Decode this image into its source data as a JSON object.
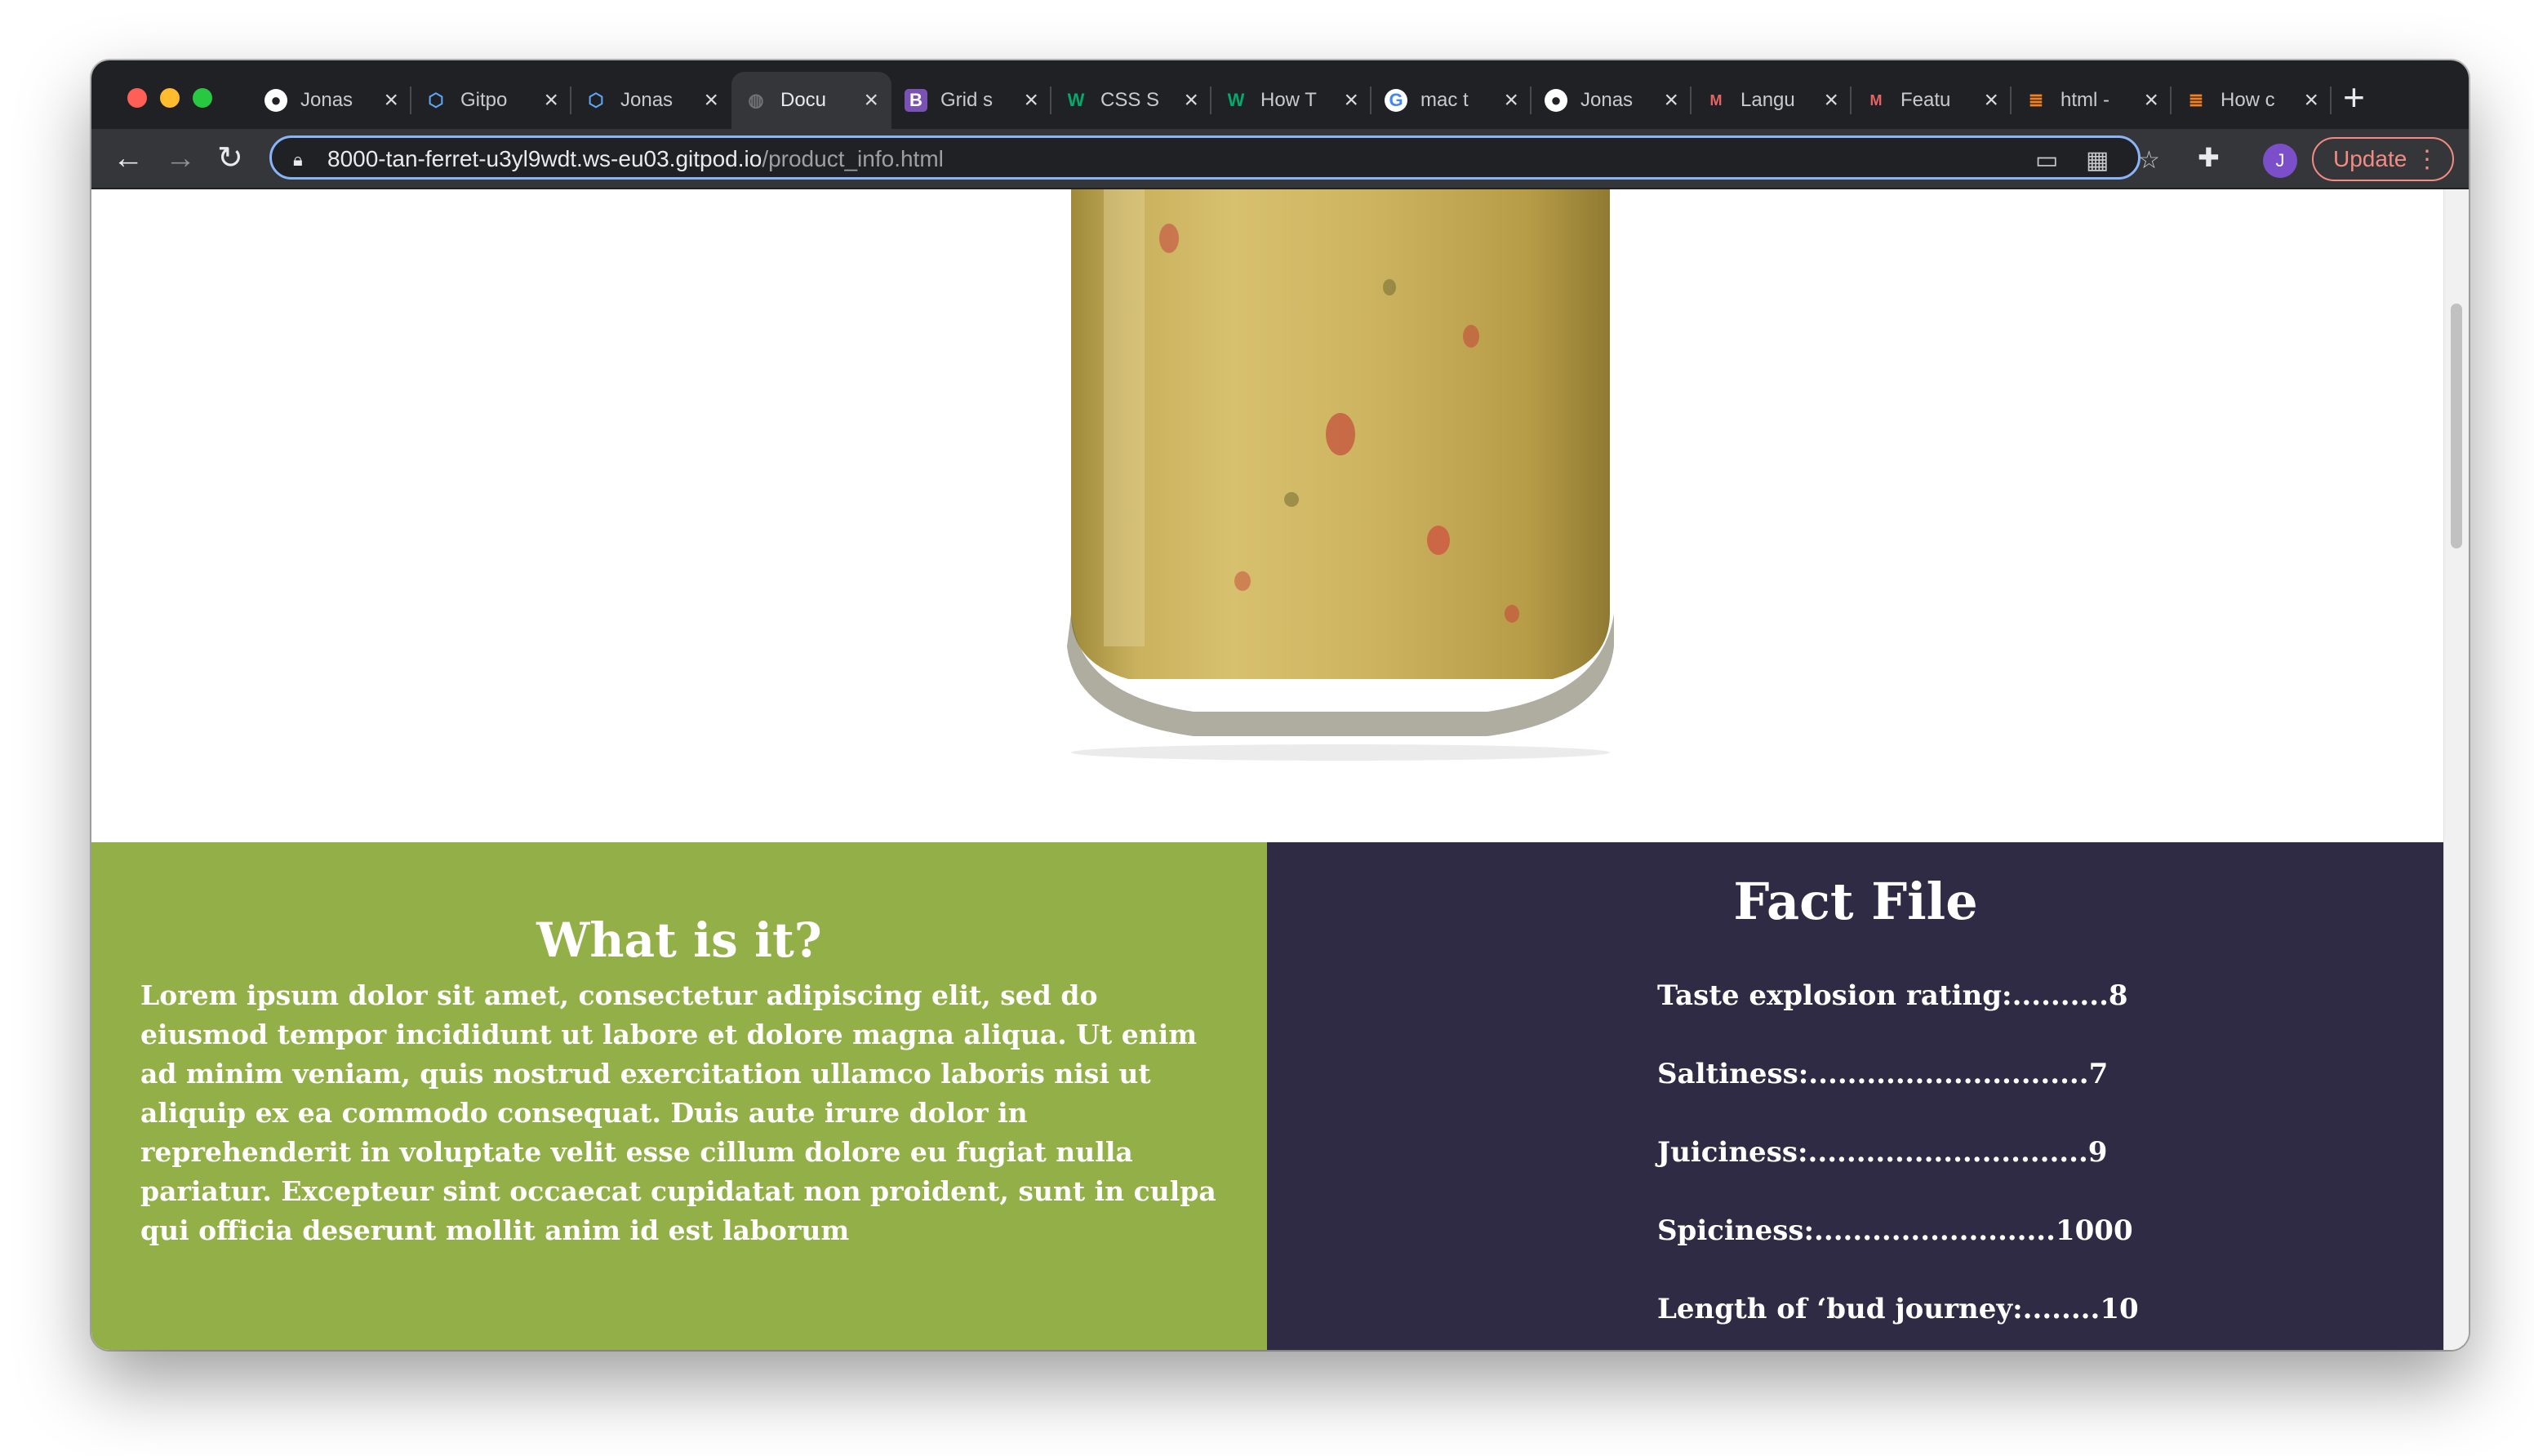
{
  "browser": {
    "tabs": [
      {
        "title": "Jonas",
        "icon": "github-icon",
        "active": false
      },
      {
        "title": "Gitpo",
        "icon": "gitpod-icon",
        "active": false
      },
      {
        "title": "Jonas",
        "icon": "gitpod-icon",
        "active": false
      },
      {
        "title": "Docu",
        "icon": "globe-icon",
        "active": true
      },
      {
        "title": "Grid s",
        "icon": "bootstrap-icon",
        "active": false
      },
      {
        "title": "CSS S",
        "icon": "w3schools-icon",
        "active": false
      },
      {
        "title": "How T",
        "icon": "w3schools-icon",
        "active": false
      },
      {
        "title": "mac t",
        "icon": "google-icon",
        "active": false
      },
      {
        "title": "Jonas",
        "icon": "github-icon",
        "active": false
      },
      {
        "title": "Langu",
        "icon": "mdn-icon",
        "active": false
      },
      {
        "title": "Featu",
        "icon": "mdn-icon",
        "active": false
      },
      {
        "title": "html -",
        "icon": "stackoverflow-icon",
        "active": false
      },
      {
        "title": "How c",
        "icon": "stackoverflow-icon",
        "active": false
      }
    ],
    "url_host": "8000-tan-ferret-u3yl9wdt.ws-eu03.gitpod.io",
    "url_path": "/product_info.html",
    "update_label": "Update",
    "avatar_initial": "J"
  },
  "page": {
    "what_title": "What is it?",
    "what_body": "Lorem ipsum dolor sit amet, consectetur adipiscing elit, sed do eiusmod tempor incididunt ut labore et dolore magna aliqua. Ut enim ad minim veniam, quis nostrud exercitation ullamco laboris nisi ut aliquip ex ea commodo consequat. Duis aute irure dolor in reprehenderit in voluptate velit esse cillum dolore eu fugiat nulla pariatur. Excepteur sint occaecat cupidatat non proident, sunt in culpa qui officia deserunt mollit anim id est laborum",
    "fact_title": "Fact File",
    "facts": [
      "Taste explosion rating:..........8",
      "Saltiness:.............................7",
      "Juiciness:.............................9",
      "Spiciness:.........................1000",
      "Length of ‘bud journey:........10"
    ]
  },
  "colors": {
    "what_bg": "#93b048",
    "fact_bg": "#302b44",
    "chrome_bg": "#202124",
    "toolbar_bg": "#35363a",
    "accent": "#8ab4f8"
  }
}
